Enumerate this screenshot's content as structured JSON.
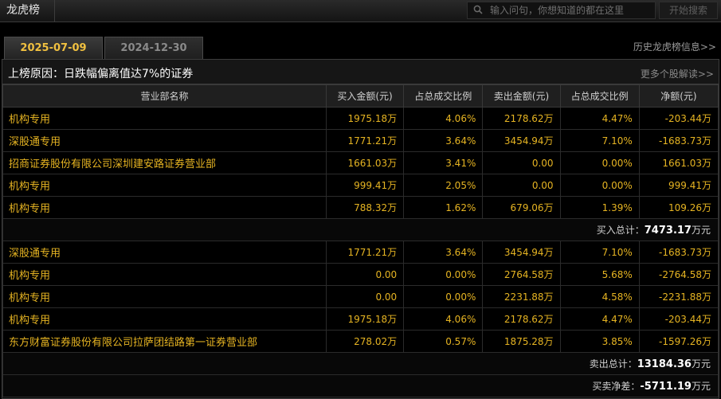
{
  "app": {
    "title": "龙虎榜"
  },
  "search": {
    "placeholder": "输入问句，你想知道的都在这里",
    "button_label": "开始搜索"
  },
  "tabs": [
    {
      "label": "2025-07-09",
      "active": true
    },
    {
      "label": "2024-12-30",
      "active": false
    }
  ],
  "history_link": "历史龙虎榜信息>>",
  "reason": {
    "label": "上榜原因：日跌幅偏离值达7%的证券",
    "more_link": "更多个股解读>>"
  },
  "table": {
    "columns": [
      "营业部名称",
      "买入金额(元)",
      "占总成交比例",
      "卖出金额(元)",
      "占总成交比例",
      "净额(元)"
    ],
    "buy_rows": [
      [
        "机构专用",
        "1975.18万",
        "4.06%",
        "2178.62万",
        "4.47%",
        "-203.44万"
      ],
      [
        "深股通专用",
        "1771.21万",
        "3.64%",
        "3454.94万",
        "7.10%",
        "-1683.73万"
      ],
      [
        "招商证券股份有限公司深圳建安路证券营业部",
        "1661.03万",
        "3.41%",
        "0.00",
        "0.00%",
        "1661.03万"
      ],
      [
        "机构专用",
        "999.41万",
        "2.05%",
        "0.00",
        "0.00%",
        "999.41万"
      ],
      [
        "机构专用",
        "788.32万",
        "1.62%",
        "679.06万",
        "1.39%",
        "109.26万"
      ]
    ],
    "buy_total": {
      "label": "买入总计：",
      "value": "7473.17",
      "unit": "万元"
    },
    "sell_rows": [
      [
        "深股通专用",
        "1771.21万",
        "3.64%",
        "3454.94万",
        "7.10%",
        "-1683.73万"
      ],
      [
        "机构专用",
        "0.00",
        "0.00%",
        "2764.58万",
        "5.68%",
        "-2764.58万"
      ],
      [
        "机构专用",
        "0.00",
        "0.00%",
        "2231.88万",
        "4.58%",
        "-2231.88万"
      ],
      [
        "机构专用",
        "1975.18万",
        "4.06%",
        "2178.62万",
        "4.47%",
        "-203.44万"
      ],
      [
        "东方财富证券股份有限公司拉萨团结路第一证券营业部",
        "278.02万",
        "0.57%",
        "1875.28万",
        "3.85%",
        "-1597.26万"
      ]
    ],
    "sell_total": {
      "label": "卖出总计：",
      "value": "13184.36",
      "unit": "万元"
    },
    "net": {
      "label": "买卖净差：",
      "value": "-5711.19",
      "unit": "万元"
    }
  },
  "colors": {
    "accent": "#e6b422",
    "background": "#000000"
  }
}
